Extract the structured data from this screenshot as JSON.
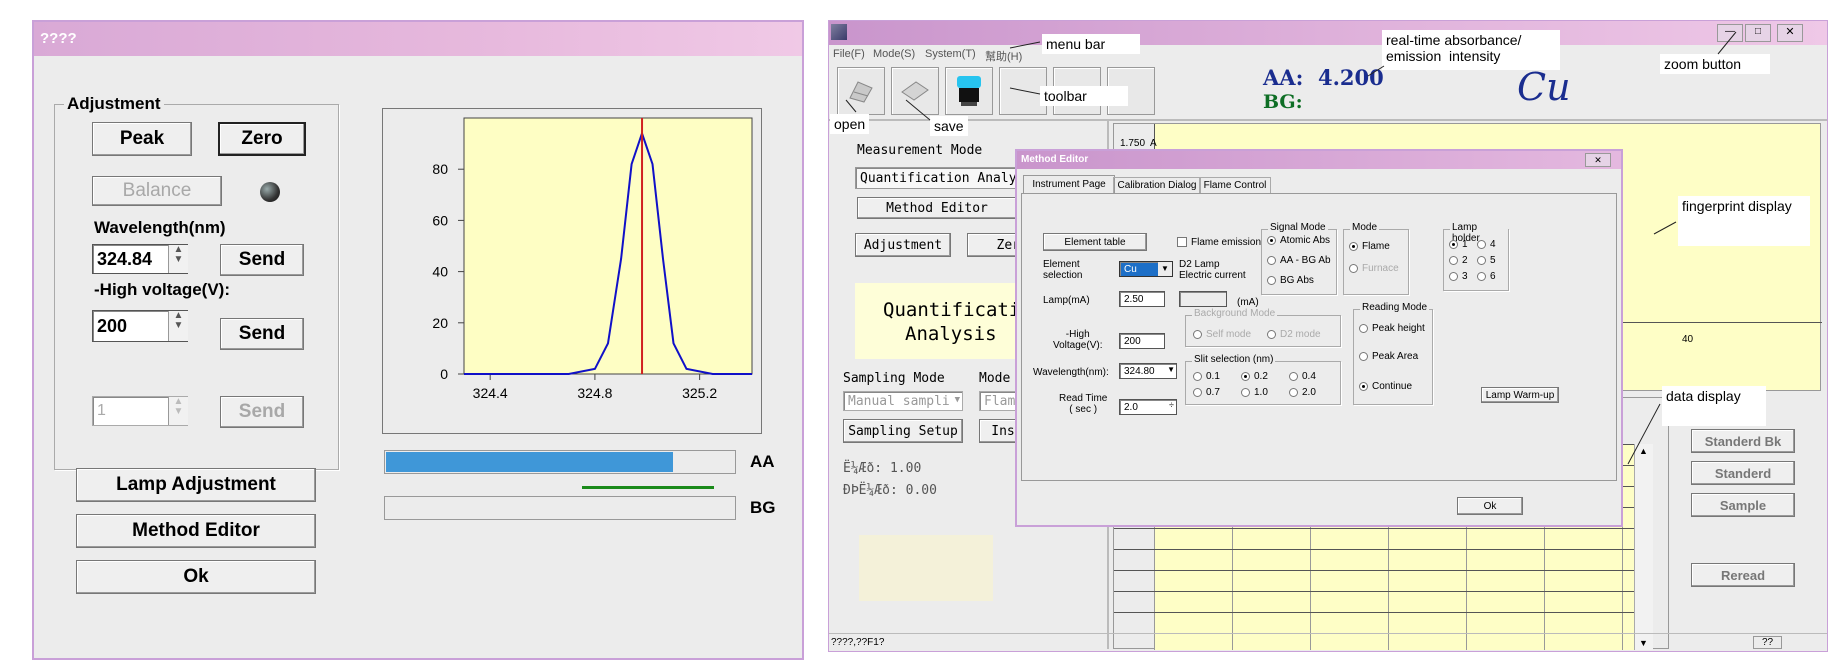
{
  "left": {
    "title": "????",
    "adjustment_group": "Adjustment",
    "peak_button": "Peak",
    "zero_button": "Zero",
    "balance_button": "Balance",
    "wavelength_label": "Wavelength(nm)",
    "wavelength_value": "324.84",
    "send_label": "Send",
    "high_voltage_label": "-High voltage(V):",
    "high_voltage_value": "200",
    "disabled_value": "1",
    "lamp_adjustment_button": "Lamp Adjustment",
    "method_editor_button": "Method Editor",
    "ok_button": "Ok",
    "aa_label": "AA",
    "bg_label": "BG",
    "aa_level": 0.82,
    "bg_level": 0.0
  },
  "chart_data": {
    "type": "line",
    "x_ticks": [
      "324.4",
      "324.8",
      "325.2"
    ],
    "y_ticks": [
      "0",
      "20",
      "40",
      "60",
      "80"
    ],
    "xlim": [
      324.3,
      325.4
    ],
    "ylim": [
      0,
      100
    ],
    "marker_x": 324.98,
    "series": [
      {
        "x": [
          324.3,
          324.7,
          324.8,
          324.85,
          324.9,
          324.94,
          324.98,
          325.02,
          325.06,
          325.1,
          325.15,
          325.25,
          325.4
        ],
        "y": [
          0,
          0,
          2,
          12,
          45,
          82,
          94,
          82,
          45,
          12,
          2,
          0,
          0
        ]
      }
    ]
  },
  "right": {
    "menu": [
      "File(F)",
      "Mode(S)",
      "System(T)",
      "幫助(H)"
    ],
    "aa_readout": "AA:  4.200",
    "bg_readout": "BG:",
    "element_display": "Cu",
    "left_panel": {
      "measurement_mode_label": "Measurement Mode",
      "measurement_mode_value": "Quantification Analy",
      "method_editor_button": "Method Editor",
      "adjustment_button": "Adjustment",
      "zero_button_partial": "Zer",
      "quant_line1": "Quantificati",
      "quant_line2": "Analysis",
      "sampling_mode_label": "Sampling Mode",
      "mode_label": "Mode",
      "sampling_select": "Manual sampli",
      "flame_select_partial": "Flam",
      "sampling_setup_button": "Sampling Setup",
      "ins_button_partial": "Ins",
      "stat1": "Ë¼Æð:  1.00",
      "stat2": "ÐÞË¼Æð:  0.00"
    },
    "y_axis_label": "1.750  A",
    "axis_tick_40": "40",
    "side_buttons": [
      "Standerd Bk",
      "Standerd",
      "Sample",
      "Reread"
    ],
    "status_bar": "????,??F1?",
    "status_right": "??",
    "annotations": {
      "menu_bar": "menu bar",
      "toolbar": "toolbar",
      "open": "open",
      "save": "save",
      "realtime": "real-time absorbance/\nemission  intensity",
      "zoom": "zoom button",
      "fingerprint": "fingerprint display",
      "data_display": "data display"
    },
    "method_editor": {
      "title": "Method Editor",
      "tabs": [
        "Instrument Page",
        "Calibration Dialog",
        "Flame Control"
      ],
      "element_table_button": "Element table",
      "flame_emission": "Flame emission",
      "element_selection_label": "Element\nselection",
      "element_value": "Cu",
      "d2_lamp_label": "D2 Lamp\nElectric current",
      "lamp_ma_label": "Lamp(mA)",
      "lamp_ma_value": "2.50",
      "ma_unit": "(mA)",
      "high_voltage_label": "-High\nVoltage(V):",
      "high_voltage_value": "200",
      "wavelength_label": "Wavelength(nm):",
      "wavelength_value": "324.80",
      "read_time_label": "Read Time\n( sec )",
      "read_time_value": "2.0",
      "signal_mode_title": "Signal Mode",
      "signal_modes": [
        "Atomic Abs",
        "AA - BG Ab",
        "BG Abs"
      ],
      "mode_title": "Mode",
      "modes": [
        "Flame",
        "Furnace"
      ],
      "lamp_holder_title": "Lamp holder",
      "lamp_holders": [
        "1",
        "4",
        "2",
        "5",
        "3",
        "6"
      ],
      "background_mode_title": "Background Mode",
      "background_modes": [
        "Self mode",
        "D2 mode"
      ],
      "slit_title": "Slit selection (nm)",
      "slits": [
        "0.1",
        "0.2",
        "0.4",
        "0.7",
        "1.0",
        "2.0"
      ],
      "reading_mode_title": "Reading Mode",
      "reading_modes": [
        "Peak height",
        "Peak Area",
        "Continue"
      ],
      "lamp_warmup_button": "Lamp Warm-up",
      "ok_button": "Ok"
    }
  }
}
